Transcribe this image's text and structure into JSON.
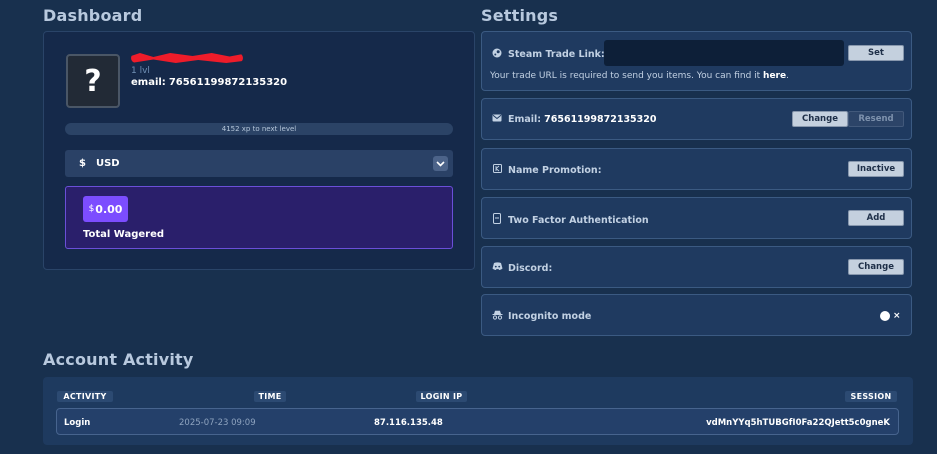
{
  "dashboard": {
    "title": "Dashboard",
    "avatar_glyph": "?",
    "level": "1 lvl",
    "email_label": "email:",
    "email_value": "76561199872135320",
    "xp_text": "4152 xp to next level",
    "currency_symbol": "$",
    "currency": "USD",
    "wager_currency": "$",
    "wager_amount": "0.00",
    "wager_label": "Total Wagered"
  },
  "settings": {
    "title": "Settings",
    "trade_link_label": "Steam Trade Link:",
    "trade_link_value": "",
    "trade_set_button": "Set",
    "trade_note": "Your trade URL is required to send you items. You can find it ",
    "trade_note_link": "here",
    "trade_note_end": ".",
    "email_label": "Email:",
    "email_value": "76561199872135320",
    "email_change_button": "Change",
    "email_resend_button": "Resend",
    "name_promo_label": "Name Promotion:",
    "name_promo_button": "Inactive",
    "twofa_label": "Two Factor Authentication",
    "twofa_button": "Add",
    "discord_label": "Discord:",
    "discord_button": "Change",
    "incognito_label": "Incognito mode",
    "incognito_toggle_glyph": "×"
  },
  "activity": {
    "title": "Account Activity",
    "columns": [
      "ACTIVITY",
      "TIME",
      "LOGIN IP",
      "SESSION"
    ],
    "rows": [
      {
        "activity": "Login",
        "time": "2025-07-23 09:09",
        "ip": "87.116.135.48",
        "session": "vdMnYYq5hTUBGfI0Fa22QJett5c0gneK"
      }
    ]
  },
  "icons": {
    "steam": "steam-icon",
    "mail": "mail-icon",
    "promo": "tag-icon",
    "twofa": "phone-icon",
    "discord": "discord-icon",
    "incognito": "incognito-icon",
    "chevron": "chevron-down-icon"
  },
  "colors": {
    "background": "#18304e",
    "accent": "#7c4dff",
    "redaction": "#ee1c2a"
  }
}
